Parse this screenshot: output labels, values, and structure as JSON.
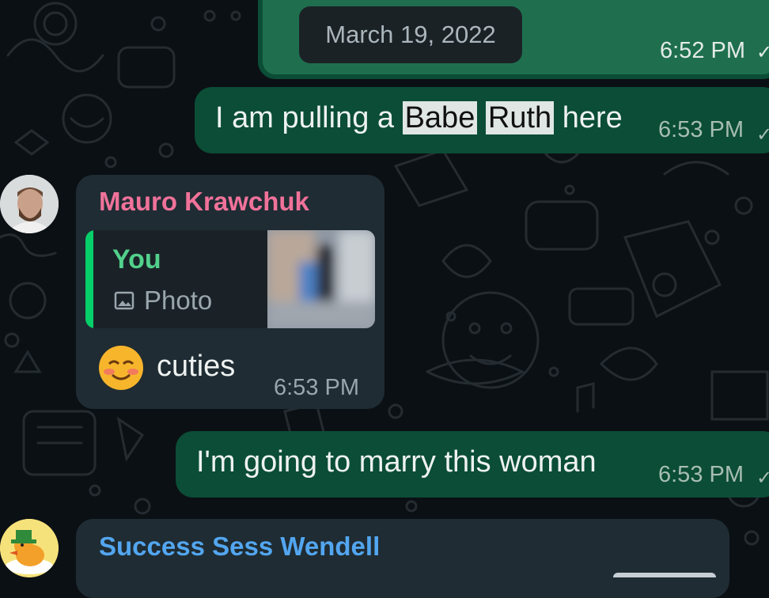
{
  "date_separator": "March 19, 2022",
  "messages": [
    {
      "id": "m0",
      "direction": "outgoing",
      "time": "6:52 PM",
      "status": "read"
    },
    {
      "id": "m1",
      "direction": "outgoing",
      "text_parts": [
        "I am pulling a ",
        "Babe",
        " ",
        "Ruth",
        " here"
      ],
      "highlighted": [
        "Babe",
        "Ruth"
      ],
      "time": "6:53 PM",
      "status": "read"
    },
    {
      "id": "m2",
      "direction": "incoming",
      "sender": "Mauro Krawchuk",
      "sender_color": "#f0729a",
      "reply": {
        "author": "You",
        "type_label": "Photo",
        "bar_color": "#06cf6a"
      },
      "text": "cuties",
      "emoji": "smiling-face-with-blushed-cheeks",
      "time": "6:53 PM"
    },
    {
      "id": "m3",
      "direction": "outgoing",
      "text": "I'm going to marry this woman",
      "time": "6:53 PM",
      "status": "read"
    },
    {
      "id": "m4",
      "direction": "incoming",
      "sender": "Success Sess Wendell",
      "sender_color": "#53a6f0"
    }
  ],
  "colors": {
    "outgoing_bubble": "#0b4d36",
    "incoming_bubble": "#1f2c33",
    "background": "#0b1014"
  }
}
